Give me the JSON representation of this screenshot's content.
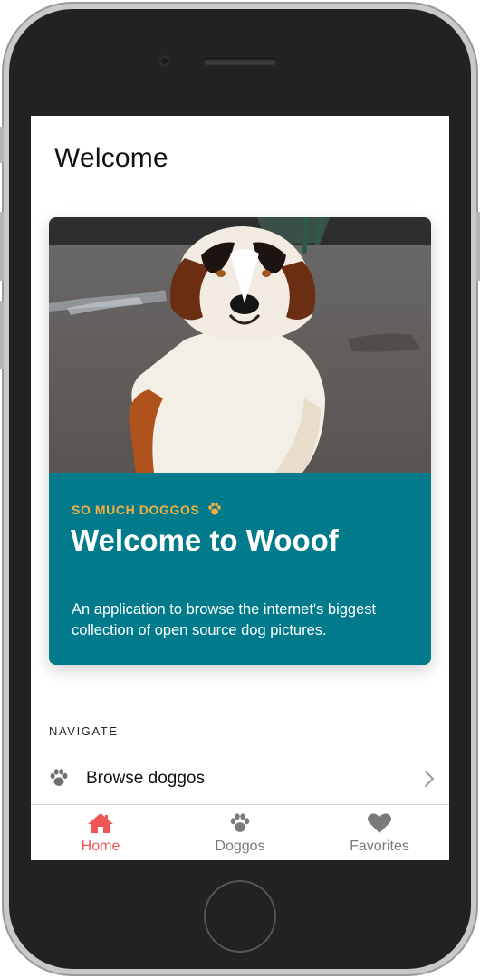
{
  "page": {
    "title": "Welcome"
  },
  "hero_card": {
    "eyebrow": "SO MUCH DOGGOS",
    "title": "Welcome to Wooof",
    "description": "An application to browse the internet's biggest collection of open source dog pictures.",
    "image_alt_icon": "dog-photo",
    "background_color": "#017a8b",
    "eyebrow_color": "#f5b041"
  },
  "navigate": {
    "section_label": "NAVIGATE",
    "items": [
      {
        "label": "Browse doggos",
        "icon": "paw-icon"
      }
    ]
  },
  "tabbar": {
    "active_color": "#ee5656",
    "inactive_color": "#7a7a7a",
    "tabs": [
      {
        "label": "Home",
        "icon": "home-icon",
        "active": true
      },
      {
        "label": "Doggos",
        "icon": "paw-icon",
        "active": false
      },
      {
        "label": "Favorites",
        "icon": "heart-icon",
        "active": false
      }
    ]
  }
}
